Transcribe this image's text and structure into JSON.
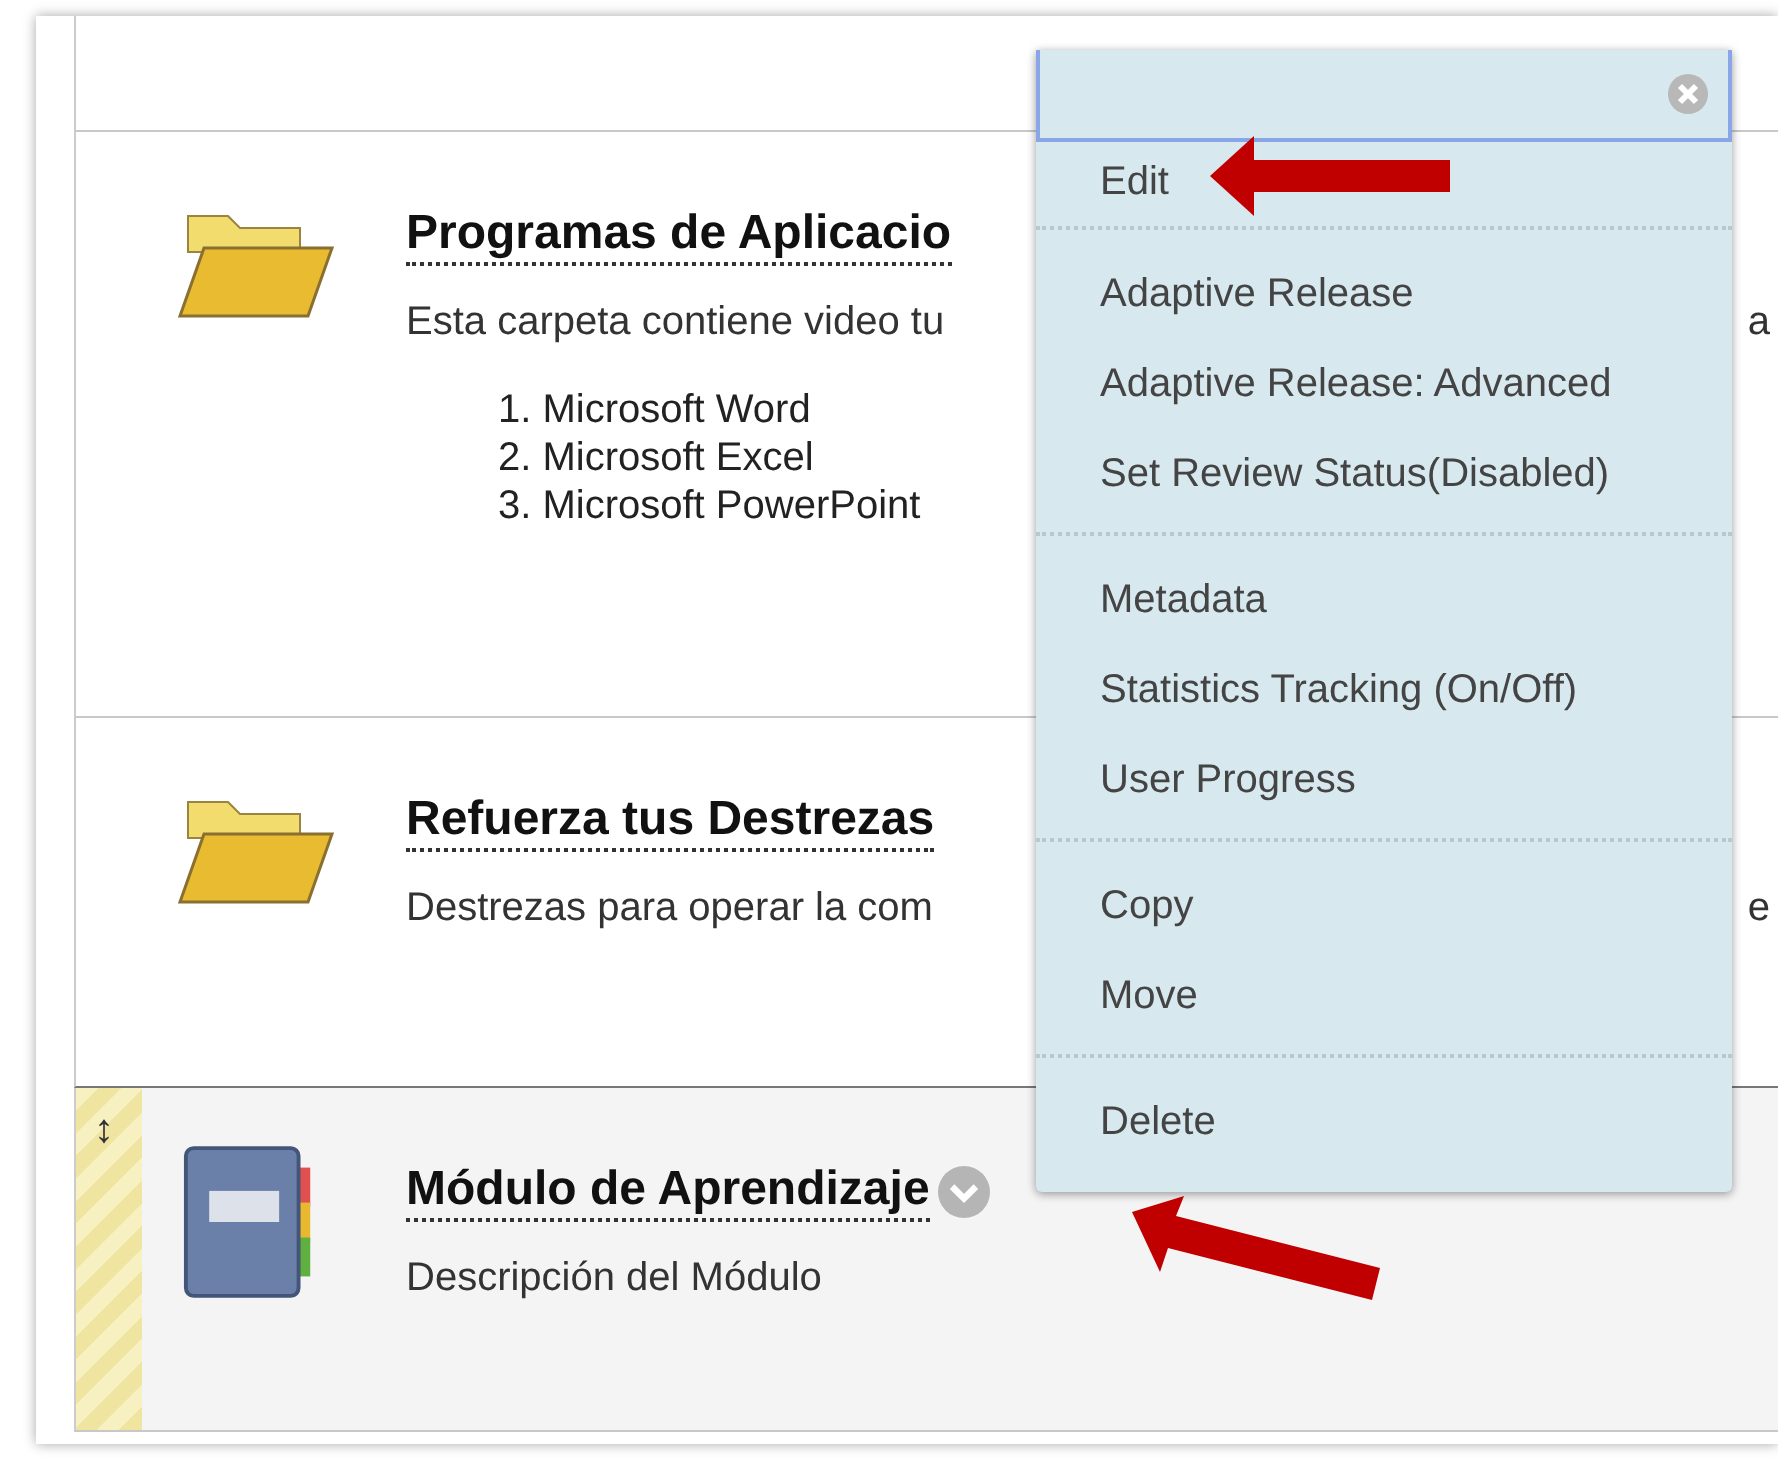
{
  "items": [
    {
      "kind": "folder",
      "title": "Programas de Aplicacio",
      "description": "Esta carpeta contiene video tu",
      "description_tail": "a",
      "list": [
        "1. Microsoft Word",
        "2. Microsoft Excel",
        "3. Microsoft PowerPoint"
      ],
      "selected": false
    },
    {
      "kind": "folder",
      "title": "Refuerza tus Destrezas",
      "description": "Destrezas para operar la com",
      "description_tail": "e",
      "selected": false
    },
    {
      "kind": "module",
      "title": "Módulo de Aprendizaje",
      "description": "Descripción del Módulo",
      "handle": "↕",
      "selected": true
    }
  ],
  "menu": {
    "groups": [
      [
        "Edit"
      ],
      [
        "Adaptive Release",
        "Adaptive Release: Advanced",
        "Set Review Status(Disabled)"
      ],
      [
        "Metadata",
        "Statistics Tracking (On/Off)",
        "User Progress"
      ],
      [
        "Copy",
        "Move"
      ],
      [
        "Delete"
      ]
    ]
  }
}
